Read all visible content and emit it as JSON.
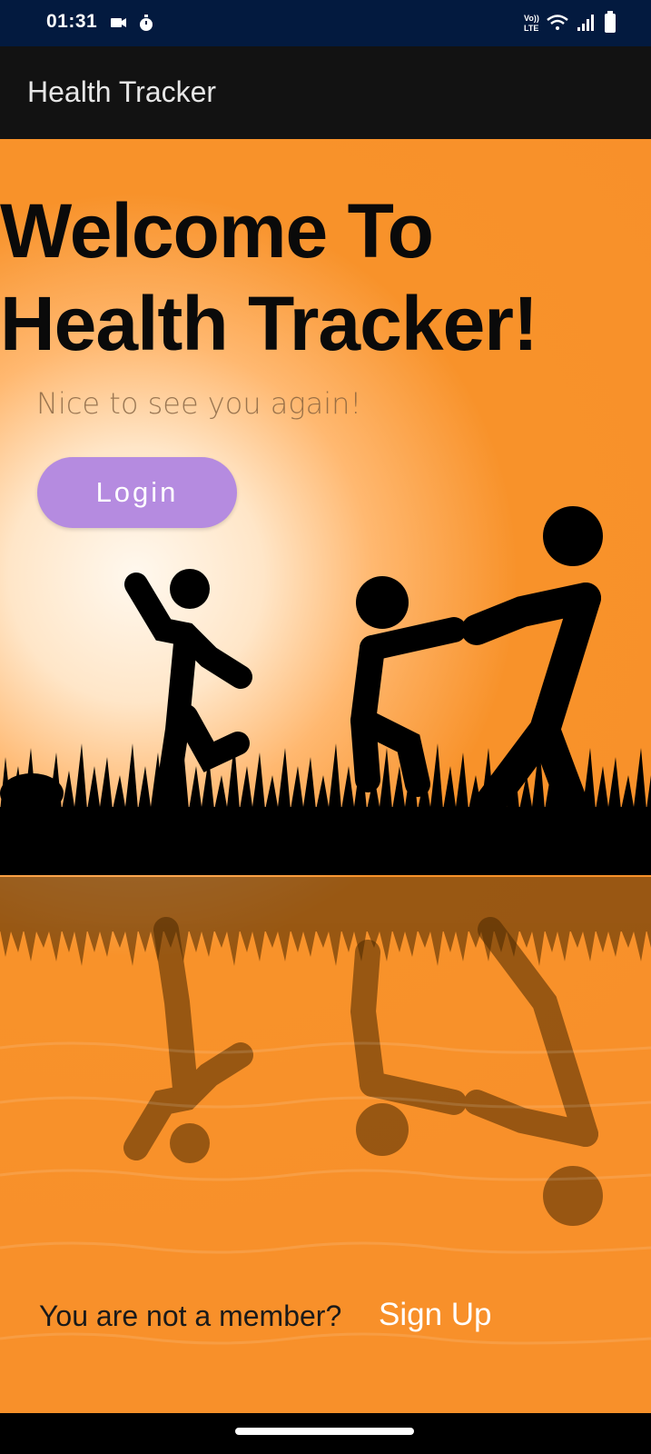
{
  "status_bar": {
    "time": "01:31",
    "icons_left": [
      "video-camera-icon",
      "stopwatch-icon"
    ],
    "icons_right": [
      "volte-icon",
      "wifi-icon",
      "signal-icon",
      "battery-icon"
    ],
    "volte_label": "Vo)) LTE"
  },
  "app_bar": {
    "title": "Health Tracker"
  },
  "main": {
    "heading_line1": "Welcome To",
    "heading_line2": "Health Tracker!",
    "subtitle": "Nice to see you again!",
    "login_label": "Login"
  },
  "footer": {
    "prompt": "You are not a member?",
    "signup_label": "Sign Up"
  },
  "colors": {
    "status_bar": "#031a3f",
    "app_bar": "#121212",
    "background_orange": "#f8922a",
    "login_button": "#b58be0",
    "signup_link": "#ffffff"
  },
  "illustration": "silhouette-children-playing-with-water-reflection"
}
